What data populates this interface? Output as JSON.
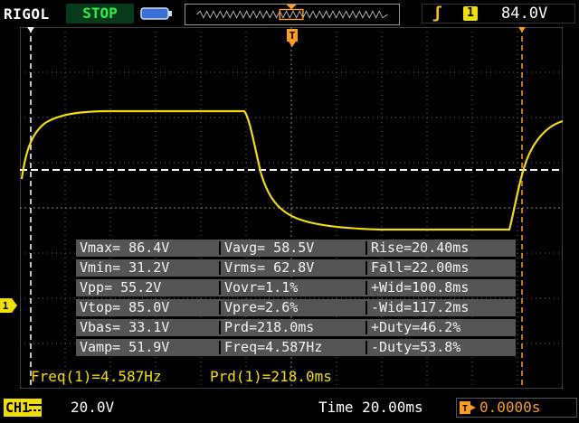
{
  "header": {
    "brand": "RIGOL",
    "status": "STOP",
    "trigger_source": "1",
    "trigger_level": "84.0V",
    "trigger_marker": "T"
  },
  "channel": {
    "marker": "1",
    "label": "CH1",
    "scale": "20.0V"
  },
  "timebase": {
    "time": "Time 20.00ms",
    "offset": "0.0000s"
  },
  "measurements": [
    [
      "Vmax= 86.4V",
      "Vavg= 58.5V",
      "Rise=20.40ms"
    ],
    [
      "Vmin= 31.2V",
      "Vrms= 62.8V",
      "Fall=22.00ms"
    ],
    [
      "Vpp= 55.2V",
      "Vovr=1.1%",
      "+Wid=100.8ms"
    ],
    [
      "Vtop= 85.0V",
      "Vpre=2.6%",
      "-Wid=117.2ms"
    ],
    [
      "Vbas= 33.1V",
      "Prd=218.0ms",
      "+Duty=46.2%"
    ],
    [
      "Vamp= 51.9V",
      "Freq=4.587Hz",
      "-Duty=53.8%"
    ]
  ],
  "footer": {
    "freq": "Freq(1)=4.587Hz",
    "prd": "Prd(1)=218.0ms"
  },
  "colors": {
    "trace": "#f0e000",
    "trigger": "#f8a01e",
    "status": "#2bf04a",
    "grid": "#555555"
  }
}
